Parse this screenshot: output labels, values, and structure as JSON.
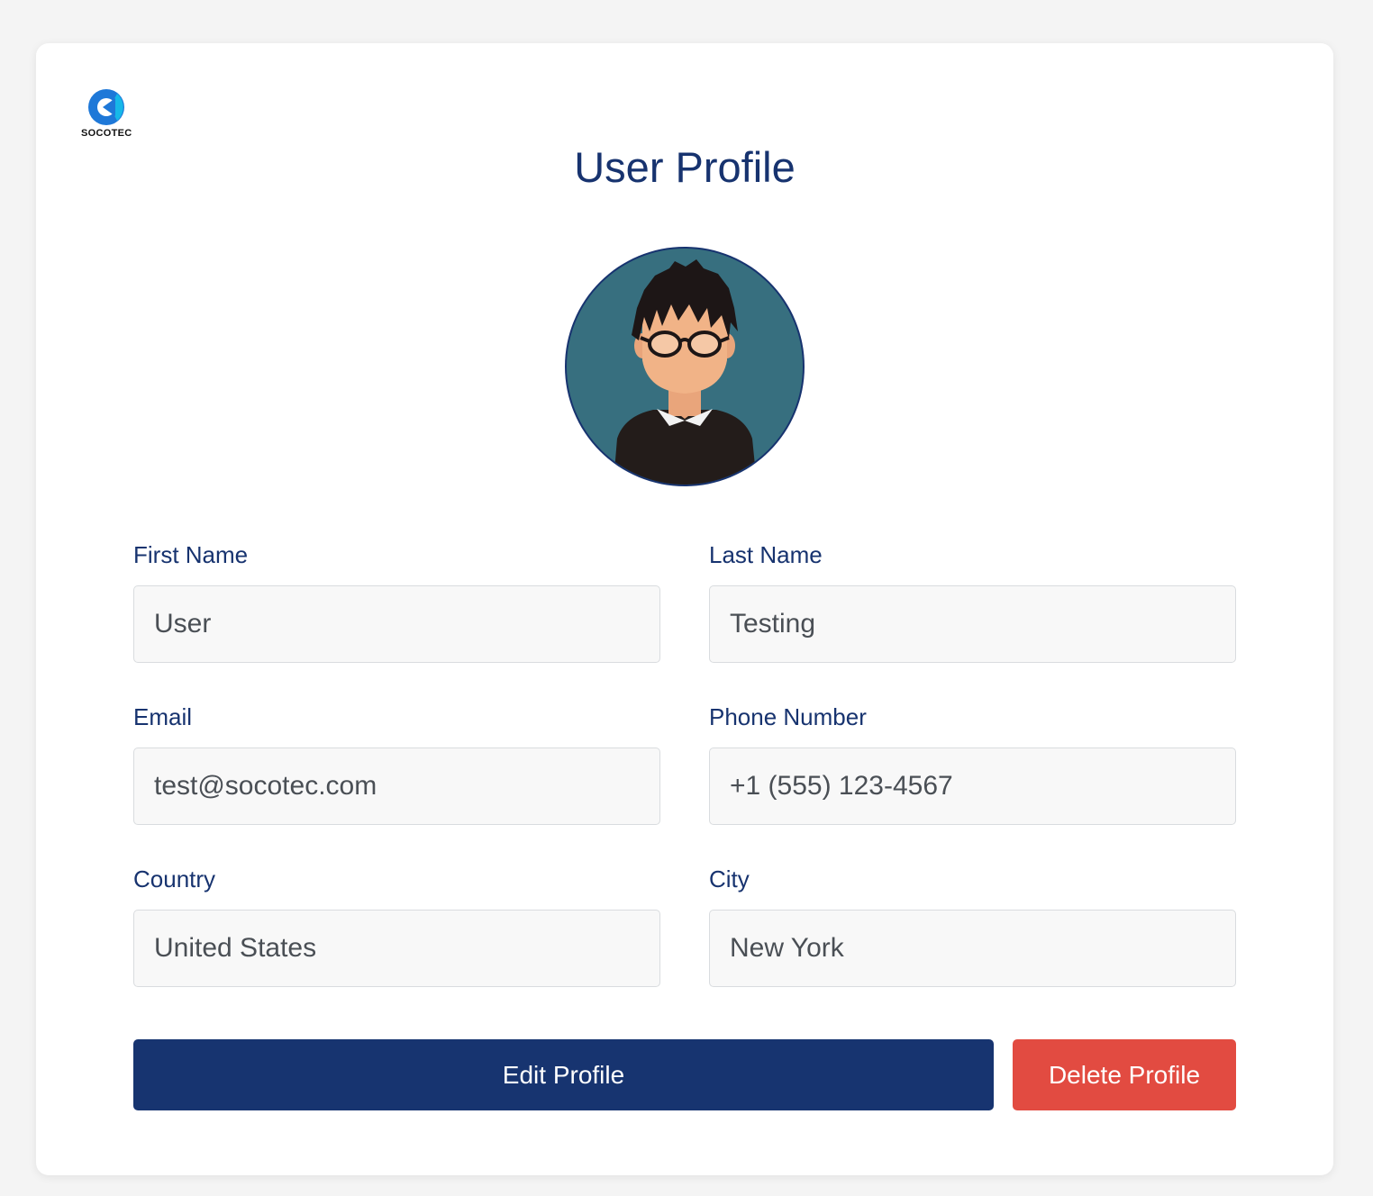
{
  "brand": {
    "name": "SOCOTEC"
  },
  "page": {
    "title": "User Profile"
  },
  "form": {
    "first_name": {
      "label": "First Name",
      "value": "User"
    },
    "last_name": {
      "label": "Last Name",
      "value": "Testing"
    },
    "email": {
      "label": "Email",
      "value": "test@socotec.com"
    },
    "phone": {
      "label": "Phone Number",
      "value": "+1 (555) 123-4567"
    },
    "country": {
      "label": "Country",
      "value": "United States"
    },
    "city": {
      "label": "City",
      "value": "New York"
    }
  },
  "actions": {
    "edit_label": "Edit Profile",
    "delete_label": "Delete Profile"
  },
  "colors": {
    "primary": "#173470",
    "danger": "#e24b41",
    "avatar_bg": "#376f7f",
    "brand_blue": "#1e78d8"
  },
  "icons": {
    "logo": "socotec-logo-icon",
    "avatar": "user-avatar-icon"
  }
}
